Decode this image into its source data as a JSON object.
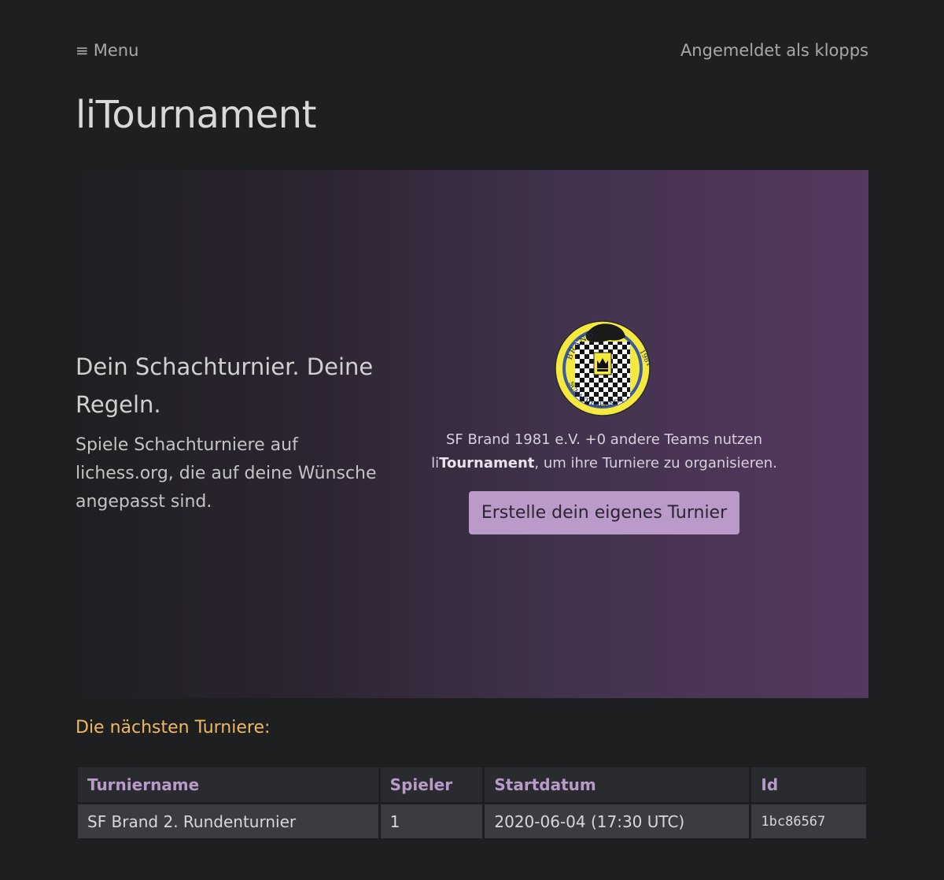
{
  "header": {
    "menu_icon": "hamburger-icon",
    "menu_label": "Menu",
    "user_label": "Angemeldet als klopps"
  },
  "page": {
    "title": "liTournament"
  },
  "hero": {
    "headline": "Dein Schachturnier. Deine Regeln.",
    "subtext": "Spiele Schachturniere auf lichess.org, die auf deine Wünsche angepasst sind.",
    "logo_icon": "sf-brand-club-logo",
    "logo_text_top": "BRAND",
    "logo_text_year": "1981",
    "logo_text_bottom": "SCHACHFREUNDE",
    "teams_prefix": "SF Brand 1981 e.V. +0 andere Teams nutzen",
    "teams_brand_plain": "li",
    "teams_brand_bold": "Tournament",
    "teams_suffix": ", um ihre Turniere zu organisieren.",
    "cta_label": "Erstelle dein eigenes Turnier"
  },
  "upcoming": {
    "heading": "Die nächsten Turniere:",
    "columns": [
      "Turniername",
      "Spieler",
      "Startdatum",
      "Id"
    ],
    "rows": [
      [
        "SF Brand 2. Rundenturnier",
        "1",
        "2020-06-04 (17:30 UTC)",
        "1bc86567"
      ]
    ]
  },
  "colors": {
    "background": "#1e1f21",
    "accent": "#b99ac8",
    "heading_orange": "#f0b860",
    "logo_yellow": "#f5e940",
    "logo_blue": "#3c5aa0"
  }
}
